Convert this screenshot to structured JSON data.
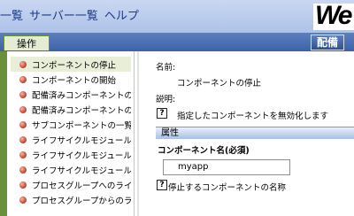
{
  "topnav": [
    "一覧",
    "サーバー一覧",
    "ヘルプ"
  ],
  "logo_text": "We",
  "tab_operations": "操作",
  "deploy_button": "配備",
  "menu": [
    {
      "label": "コンポーネントの停止",
      "active": true
    },
    {
      "label": "コンポーネントの開始"
    },
    {
      "label": "配備済みコンポーネントの一"
    },
    {
      "label": "配備済みコンポーネントの"
    },
    {
      "label": "サブコンポーネントの一覧表"
    },
    {
      "label": "ライフサイクルモジュールの"
    },
    {
      "label": "ライフサイクルモジュールの"
    },
    {
      "label": "ライフサイクルモジュール削"
    },
    {
      "label": "プロセスグループへのライ"
    },
    {
      "label": "プロセスグループからのラ"
    }
  ],
  "detail": {
    "name_label": "名前:",
    "name_value": "コンポーネントの停止",
    "description_label": "説明:",
    "description_text": "指定したコンポーネントを無効化します",
    "attributes_header": "属性",
    "component_name_label": "コンポーネント名(必須)",
    "component_name_value": "myapp",
    "component_name_help": "停止するコンポーネントの名称"
  },
  "colors": {
    "topbar": "#aec2e8",
    "subbar": "#3d62a7",
    "nav_text": "#1c3a86",
    "left_accent": "#6b8f3a",
    "bullet": "#c84d35"
  }
}
